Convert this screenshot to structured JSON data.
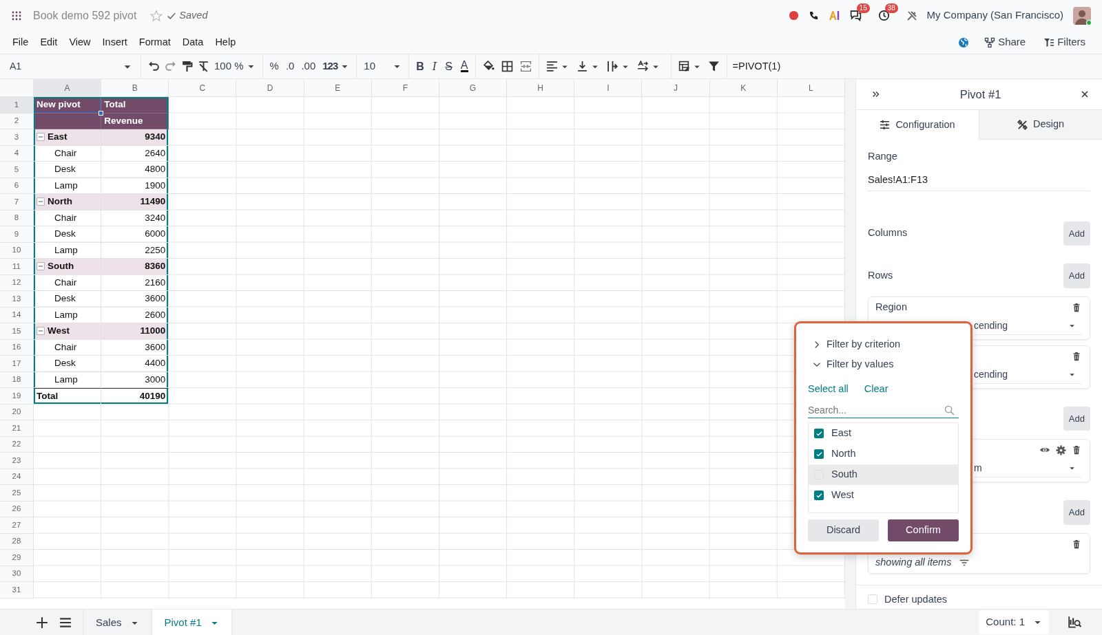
{
  "app": {
    "title": "Book demo 592 pivot",
    "favorite": false,
    "save_status": "Saved",
    "company": "My Company (San Francisco)",
    "badges": [
      {
        "kind": "chat",
        "count": "15"
      },
      {
        "kind": "activity",
        "count": "38"
      }
    ]
  },
  "menu": [
    "File",
    "Edit",
    "View",
    "Insert",
    "Format",
    "Data",
    "Help"
  ],
  "header_actions": [
    "Share",
    "Filters"
  ],
  "toolbar": {
    "cell_ref": "A1",
    "zoom": "100 %",
    "number_formats": [
      "%",
      ".0",
      ".00",
      "123"
    ],
    "font_size": "10",
    "text_styles": [
      {
        "kind": "bold",
        "label": "B"
      },
      {
        "kind": "italic",
        "label": "I"
      },
      {
        "kind": "strike",
        "label": "S"
      },
      {
        "kind": "color",
        "label": "A"
      }
    ],
    "formula": "=PIVOT(1)"
  },
  "sheet": {
    "columns": [
      {
        "label": "A",
        "selected": true
      },
      {
        "label": "B",
        "selected": false
      },
      {
        "label": "C",
        "selected": false
      },
      {
        "label": "D",
        "selected": false
      },
      {
        "label": "E",
        "selected": false
      },
      {
        "label": "F",
        "selected": false
      },
      {
        "label": "G",
        "selected": false
      },
      {
        "label": "H",
        "selected": false
      },
      {
        "label": "I",
        "selected": false
      },
      {
        "label": "J",
        "selected": false
      },
      {
        "label": "K",
        "selected": false
      },
      {
        "label": "L",
        "selected": false
      }
    ],
    "row_numbers": [
      "1",
      "2",
      "3",
      "4",
      "5",
      "6",
      "7",
      "8",
      "9",
      "10",
      "11",
      "12",
      "13",
      "14",
      "15",
      "16",
      "17",
      "18",
      "19",
      "20",
      "21",
      "22",
      "23",
      "24",
      "25",
      "26",
      "27",
      "28",
      "29",
      "30",
      "31"
    ],
    "pivot": [
      {
        "kind": "header",
        "label": "New pivot",
        "value": "Total"
      },
      {
        "kind": "subheader",
        "value": "Revenue"
      },
      {
        "kind": "group",
        "label": "East",
        "value": "9340",
        "expanded": true
      },
      {
        "kind": "item",
        "label": "Chair",
        "value": "2640"
      },
      {
        "kind": "item",
        "label": "Desk",
        "value": "4800"
      },
      {
        "kind": "item",
        "label": "Lamp",
        "value": "1900"
      },
      {
        "kind": "group",
        "label": "North",
        "value": "11490",
        "expanded": true
      },
      {
        "kind": "item",
        "label": "Chair",
        "value": "3240"
      },
      {
        "kind": "item",
        "label": "Desk",
        "value": "6000"
      },
      {
        "kind": "item",
        "label": "Lamp",
        "value": "2250"
      },
      {
        "kind": "group",
        "label": "South",
        "value": "8360",
        "expanded": true
      },
      {
        "kind": "item",
        "label": "Chair",
        "value": "2160"
      },
      {
        "kind": "item",
        "label": "Desk",
        "value": "3600"
      },
      {
        "kind": "item",
        "label": "Lamp",
        "value": "2600"
      },
      {
        "kind": "group",
        "label": "West",
        "value": "11000",
        "expanded": true
      },
      {
        "kind": "item",
        "label": "Chair",
        "value": "3600"
      },
      {
        "kind": "item",
        "label": "Desk",
        "value": "4400"
      },
      {
        "kind": "item",
        "label": "Lamp",
        "value": "3000"
      },
      {
        "kind": "total",
        "label": "Total",
        "value": "40190"
      }
    ]
  },
  "panel": {
    "title": "Pivot #1",
    "tabs": [
      {
        "kind": "config",
        "label": "Configuration",
        "selected": true
      },
      {
        "kind": "design",
        "label": "Design",
        "selected": false
      }
    ],
    "range_label": "Range",
    "range": "Sales!A1:F13",
    "sections": [
      {
        "label": "Columns",
        "add": "Add"
      },
      {
        "label": "Rows",
        "add": "Add",
        "items": [
          {
            "kind": "dimension",
            "name": "Region",
            "sort": "cending"
          },
          {
            "kind": "dimension",
            "sort": "cending"
          }
        ]
      },
      {
        "add": "Add",
        "items": [
          {
            "kind": "measure",
            "sort": "m"
          }
        ]
      },
      {
        "add": "Add",
        "items": [
          {
            "kind": "filter",
            "note": "showing all items"
          }
        ]
      }
    ],
    "defer_updates": {
      "label": "Defer updates",
      "checked": false
    }
  },
  "filter_popup": {
    "sections": [
      {
        "label": "Filter by criterion",
        "expanded": false
      },
      {
        "label": "Filter by values",
        "expanded": true
      }
    ],
    "links": [
      "Select all",
      "Clear"
    ],
    "search_placeholder": "Search...",
    "values": [
      {
        "label": "East",
        "checked": true,
        "hovered": false
      },
      {
        "label": "North",
        "checked": true,
        "hovered": false
      },
      {
        "label": "South",
        "checked": false,
        "hovered": true
      },
      {
        "label": "West",
        "checked": true,
        "hovered": false
      }
    ],
    "buttons": [
      {
        "label": "Discard",
        "primary": false
      },
      {
        "label": "Confirm",
        "primary": true
      }
    ]
  },
  "bottom_bar": {
    "sheets": [
      {
        "label": "Sales",
        "selected": false
      },
      {
        "label": "Pivot #1",
        "selected": true
      }
    ],
    "count": "Count: 1"
  }
}
